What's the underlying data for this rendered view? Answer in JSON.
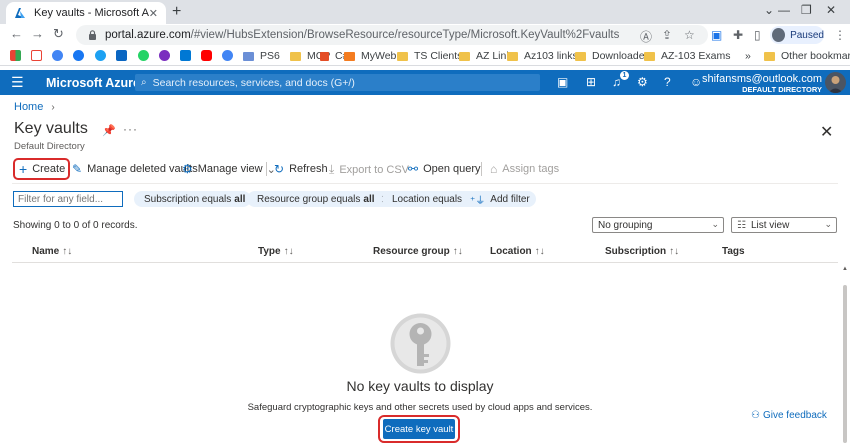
{
  "browser": {
    "tab_title": "Key vaults - Microsoft Azure",
    "tab_close": "✕",
    "new_tab": "+",
    "url_host": "portal.azure.com",
    "url_rest": "/#view/HubsExtension/BrowseResource/resourceType/Microsoft.KeyVault%2Fvaults",
    "profile_status": "Paused",
    "bookmarks": [
      "PS6",
      "MCP",
      "C#",
      "MyWeb",
      "TS Clients",
      "AZ Link",
      "Az103 links",
      "Downloader",
      "AZ-103 Exams"
    ],
    "bookmarks_overflow": "»",
    "other_bookmarks": "Other bookmarks"
  },
  "azure": {
    "brand": "Microsoft Azure",
    "search_placeholder": "Search resources, services, and docs (G+/)",
    "notification_count": "1",
    "user_email": "shifansms@outlook.com",
    "user_directory": "DEFAULT DIRECTORY"
  },
  "page": {
    "breadcrumb_home": "Home",
    "title": "Key vaults",
    "subtitle": "Default Directory"
  },
  "commands": {
    "create": "Create",
    "manage_deleted": "Manage deleted vaults",
    "manage_view": "Manage view",
    "refresh": "Refresh",
    "export_csv": "Export to CSV",
    "open_query": "Open query",
    "assign_tags": "Assign tags"
  },
  "filters": {
    "placeholder": "Filter for any field...",
    "pills": [
      {
        "label": "Subscription equals",
        "value": "all"
      },
      {
        "label": "Resource group equals",
        "value": "all"
      },
      {
        "label": "Location equals",
        "value": "all"
      }
    ],
    "add_filter": "Add filter"
  },
  "records": "Showing 0 to 0 of 0 records.",
  "grouping": "No grouping",
  "view": "List view",
  "columns": [
    "Name",
    "Type",
    "Resource group",
    "Location",
    "Subscription",
    "Tags"
  ],
  "empty": {
    "title": "No key vaults to display",
    "description": "Safeguard cryptographic keys and other secrets used by cloud apps and services.",
    "button": "Create key vault"
  },
  "feedback": "Give feedback",
  "colors": {
    "azure_blue": "#0f6cbd",
    "highlight_red": "#d92b2b"
  }
}
